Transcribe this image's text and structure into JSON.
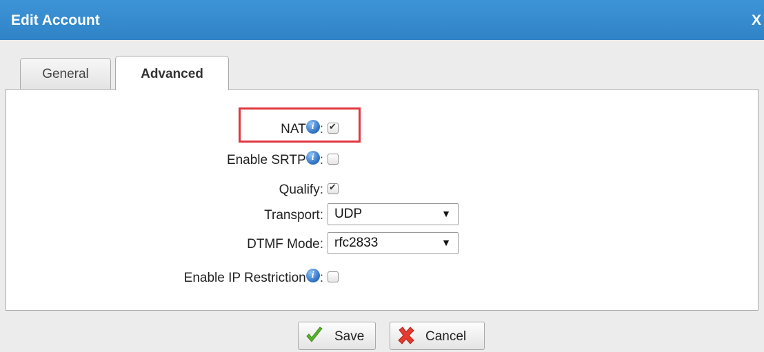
{
  "dialog": {
    "title": "Edit Account",
    "close_label": "X"
  },
  "tabs": [
    {
      "label": "General",
      "active": false
    },
    {
      "label": "Advanced",
      "active": true
    }
  ],
  "fields": {
    "nat": {
      "label": "NAT",
      "checked": true,
      "has_info": true
    },
    "enable_srtp": {
      "label": "Enable SRTP",
      "checked": false,
      "has_info": true
    },
    "qualify": {
      "label": "Qualify",
      "checked": true,
      "has_info": false
    },
    "transport": {
      "label": "Transport",
      "value": "UDP"
    },
    "dtmf_mode": {
      "label": "DTMF Mode",
      "value": "rfc2833"
    },
    "enable_ip_restriction": {
      "label": "Enable IP Restriction",
      "checked": false,
      "has_info": true
    }
  },
  "colon": ":",
  "info_glyph": "i",
  "arrow_glyph": "▼",
  "buttons": {
    "save": "Save",
    "cancel": "Cancel"
  },
  "colors": {
    "titlebar": "#3188ca",
    "highlight": "#e0363e",
    "save_icon": "#59b22a",
    "cancel_icon": "#e53a2f"
  }
}
